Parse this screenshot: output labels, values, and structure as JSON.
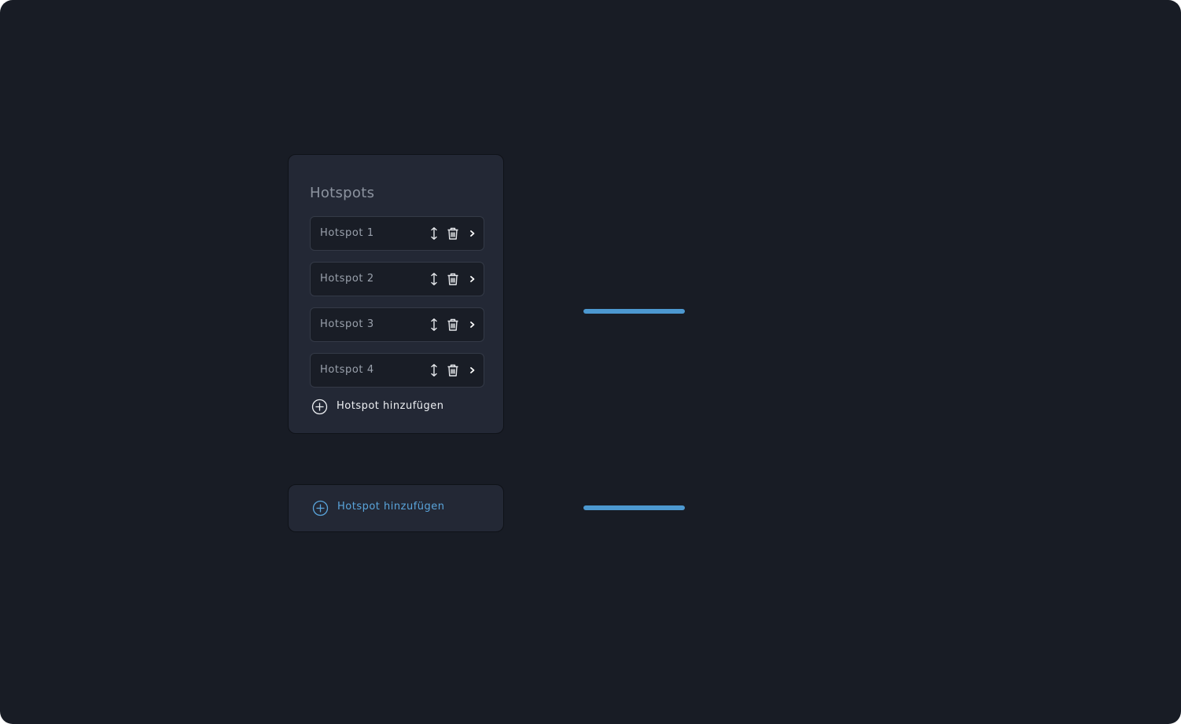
{
  "panel": {
    "title": "Hotspots",
    "items": [
      {
        "label": "Hotspot 1"
      },
      {
        "label": "Hotspot 2"
      },
      {
        "label": "Hotspot 3"
      },
      {
        "label": "Hotspot 4"
      }
    ],
    "add_label": "Hotspot hinzufügen"
  },
  "hover_state": {
    "add_label": "Hotspot hinzufügen"
  },
  "icons": {
    "move": "move-vertical-icon",
    "delete": "trash-icon",
    "open": "chevron-right-icon",
    "add": "plus-circle-icon"
  },
  "colors": {
    "background": "#181c25",
    "panel": "#232835",
    "item": "#191d26",
    "accent": "#4c98d0",
    "accent_text": "#5aa5dc",
    "text_primary": "#eef0f3",
    "text_muted": "#9aa1ac"
  }
}
